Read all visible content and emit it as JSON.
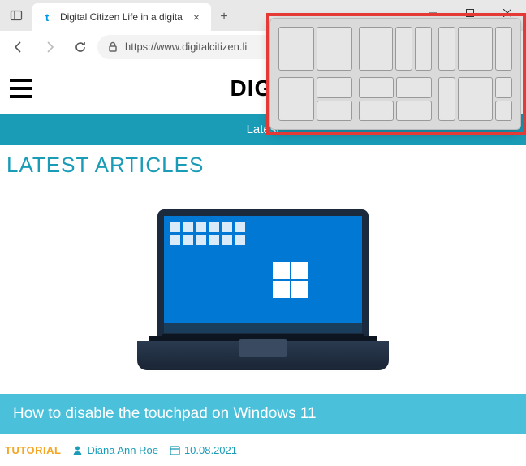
{
  "tab": {
    "favicon": "t",
    "title": "Digital Citizen Life in a digital wo"
  },
  "address_bar": {
    "url": "https://www.digitalcitizen.li"
  },
  "page": {
    "logo_text": "DIGITAL",
    "nav_label": "Latest",
    "section_title": "LATEST ARTICLES"
  },
  "article": {
    "title": "How to disable the touchpad on Windows 11",
    "category": "TUTORIAL",
    "author": "Diana Ann Roe",
    "date": "10.08.2021"
  }
}
